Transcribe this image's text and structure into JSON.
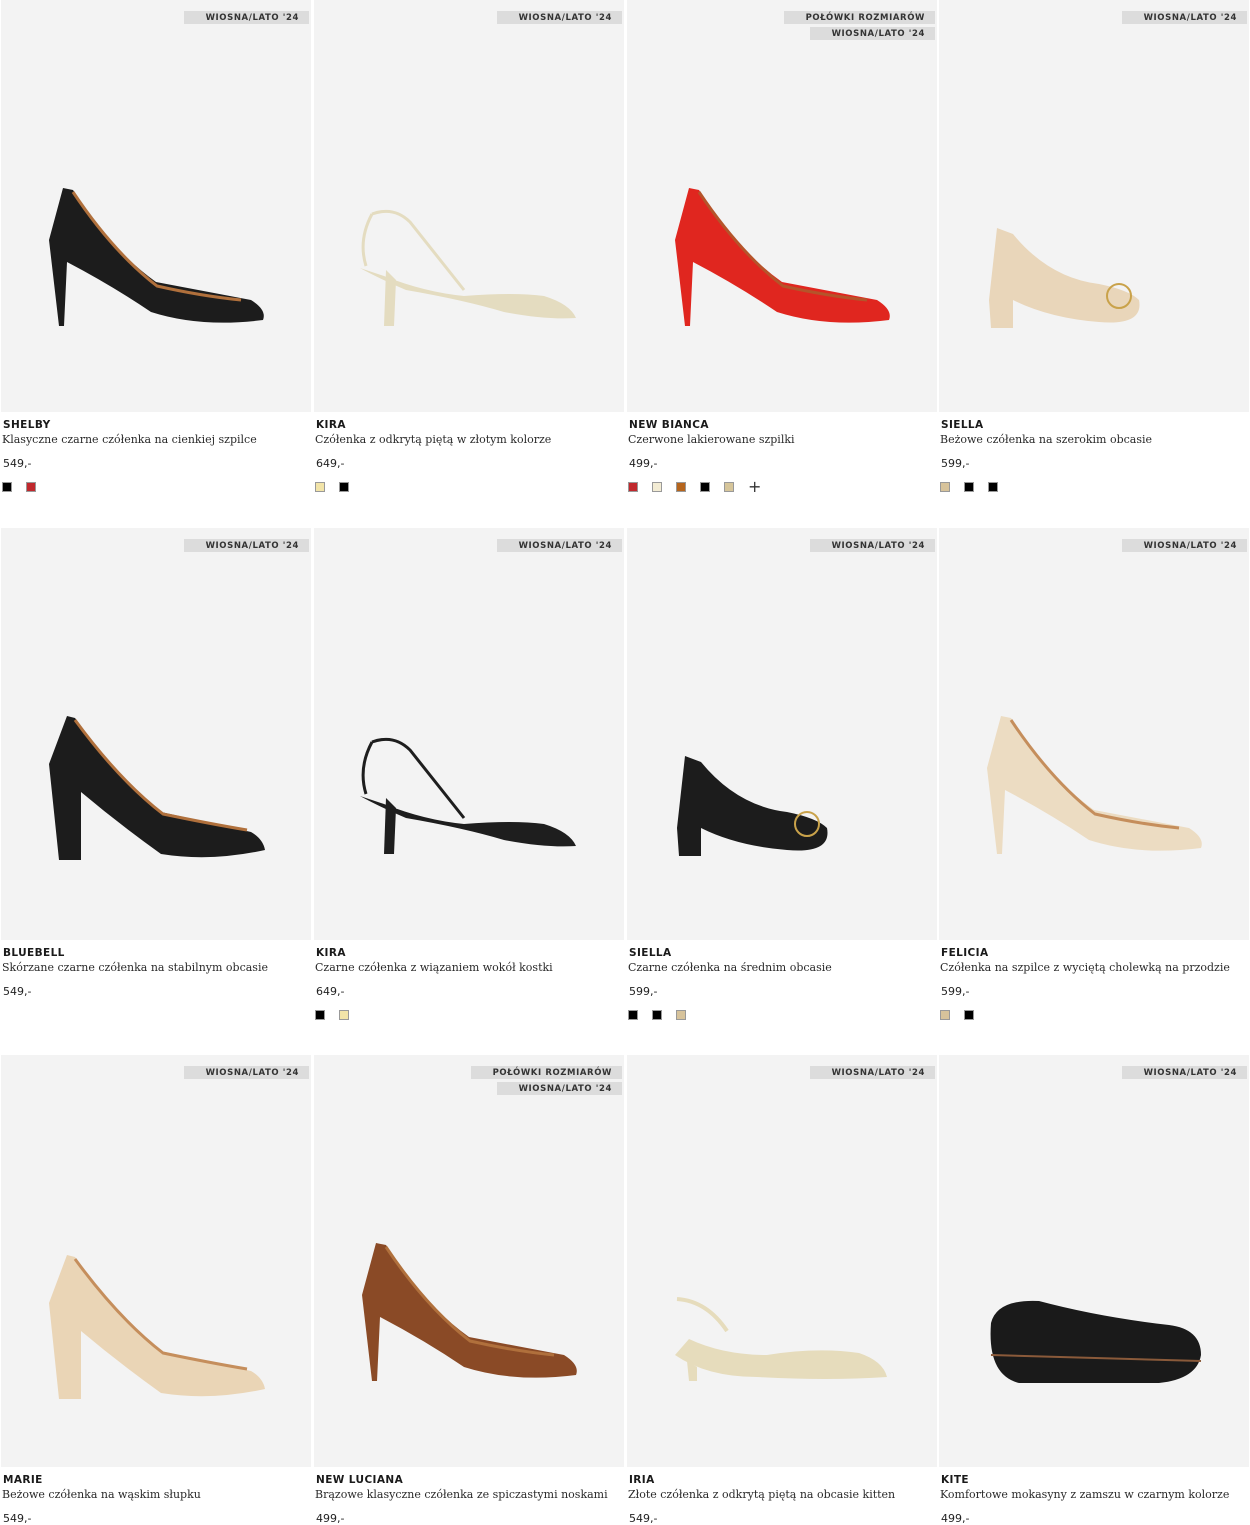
{
  "products": [
    {
      "name": "SHELBY",
      "desc": "Klasyczne czarne czółenka na cienkiej szpilce",
      "price": "549,-",
      "badges": [
        "WIOSNA/LATO '24"
      ],
      "shoe": "pump-stiletto",
      "color": "#1c1c1c",
      "inner": "#b0703c",
      "swatches": [
        "#000000",
        "#c0282d"
      ],
      "more": false
    },
    {
      "name": "KIRA",
      "desc": "Czółenka z odkrytą piętą w złotym kolorze",
      "price": "649,-",
      "badges": [
        "WIOSNA/LATO '24"
      ],
      "shoe": "slingback-strap",
      "color": "#e4dcc0",
      "inner": "#c99a6a",
      "swatches": [
        "#f2e4a8",
        "#000000"
      ],
      "more": false
    },
    {
      "name": "NEW BIANCA",
      "desc": "Czerwone lakierowane szpilki",
      "price": "499,-",
      "badges": [
        "POŁÓWKI ROZMIARÓW",
        "WIOSNA/LATO '24"
      ],
      "shoe": "pump-stiletto",
      "color": "#e0261f",
      "inner": "#b5542a",
      "swatches": [
        "#c0282d",
        "#f3ecd4",
        "#b5651d",
        "#000000",
        "#d6c59a"
      ],
      "more": true
    },
    {
      "name": "SIELLA",
      "desc": "Beżowe czółenka na szerokim obcasie",
      "price": "599,-",
      "badges": [
        "WIOSNA/LATO '24"
      ],
      "shoe": "pump-block-low",
      "color": "#e9d6ba",
      "inner": "#c58e5c",
      "swatches": [
        "#d7c39b",
        "#000000",
        "#000000"
      ],
      "more": false
    },
    {
      "name": "BLUEBELL",
      "desc": "Skórzane czarne czółenka na stabilnym obcasie",
      "price": "549,-",
      "badges": [
        "WIOSNA/LATO '24"
      ],
      "shoe": "pump-block-high",
      "color": "#1c1c1c",
      "inner": "#b0703c",
      "swatches": [],
      "more": false
    },
    {
      "name": "KIRA",
      "desc": "Czarne czółenka z wiązaniem wokół kostki",
      "price": "649,-",
      "badges": [
        "WIOSNA/LATO '24"
      ],
      "shoe": "slingback-strap",
      "color": "#1e1e1e",
      "inner": "#b0703c",
      "swatches": [
        "#000000",
        "#f2e4a8"
      ],
      "more": false
    },
    {
      "name": "SIELLA",
      "desc": "Czarne czółenka na średnim obcasie",
      "price": "599,-",
      "badges": [
        "WIOSNA/LATO '24"
      ],
      "shoe": "pump-block-low",
      "color": "#1c1c1c",
      "inner": "#b0703c",
      "swatches": [
        "#000000",
        "#000000",
        "#d7c39b"
      ],
      "more": false
    },
    {
      "name": "FELICIA",
      "desc": "Czółenka na szpilce z wyciętą cholewką na przodzie",
      "price": "599,-",
      "badges": [
        "WIOSNA/LATO '24"
      ],
      "shoe": "pump-stiletto",
      "color": "#ecdcc2",
      "inner": "#c58e5c",
      "swatches": [
        "#d7c39b",
        "#000000"
      ],
      "more": false
    },
    {
      "name": "MARIE",
      "desc": "Beżowe czółenka na wąskim słupku",
      "price": "549,-",
      "badges": [
        "WIOSNA/LATO '24"
      ],
      "shoe": "pump-block-high",
      "color": "#ead5b6",
      "inner": "#c58e5c",
      "swatches": [],
      "more": false
    },
    {
      "name": "NEW LUCIANA",
      "desc": "Brązowe klasyczne czółenka ze spiczastymi noskami",
      "price": "499,-",
      "badges": [
        "POŁÓWKI ROZMIARÓW",
        "WIOSNA/LATO '24"
      ],
      "shoe": "pump-stiletto",
      "color": "#8a4a26",
      "inner": "#b0703c",
      "swatches": [],
      "more": false
    },
    {
      "name": "IRIA",
      "desc": "Złote czółenka z odkrytą piętą na obcasie kitten",
      "price": "549,-",
      "badges": [
        "WIOSNA/LATO '24"
      ],
      "shoe": "slingback-kitten",
      "color": "#e6dcbc",
      "inner": "#c99a6a",
      "swatches": [],
      "more": false
    },
    {
      "name": "KITE",
      "desc": "Komfortowe mokasyny z zamszu w czarnym kolorze",
      "price": "499,-",
      "badges": [
        "WIOSNA/LATO '24"
      ],
      "shoe": "loafer",
      "color": "#1a1a1a",
      "inner": "#8a5a3a",
      "swatches": [],
      "more": false
    }
  ]
}
